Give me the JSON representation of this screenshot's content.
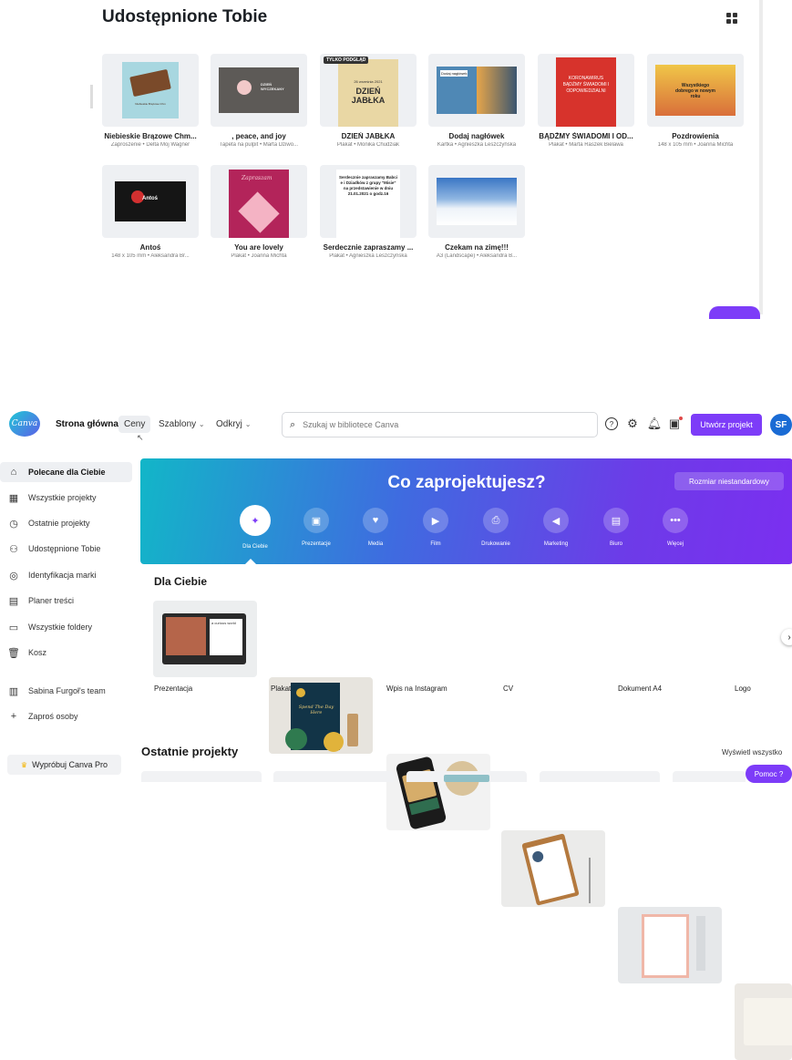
{
  "shared": {
    "title": "Udostępnione Tobie",
    "items": [
      {
        "title": "Niebieskie Brązowe Chm...",
        "meta": "Zaproszenie • Delta Moj Wagner",
        "tag": ""
      },
      {
        "title": ", peace, and joy",
        "meta": "Tapeta na pulpit • Marta Dziwo...",
        "tag": ""
      },
      {
        "title": "DZIEŃ JABŁKA",
        "meta": "Plakat • Monika Chudziak",
        "tag": "TYLKO PODGLĄD"
      },
      {
        "title": "Dodaj nagłówek",
        "meta": "Kartka • Agnieszka Leszczyńska",
        "tag": ""
      },
      {
        "title": "BĄDŹMY ŚWIADOMI I OD...",
        "meta": "Plakat • Marta Raszek Bielawa",
        "tag": ""
      },
      {
        "title": "Pozdrowienia",
        "meta": "148 x 105 mm • Joanna Michta",
        "tag": ""
      },
      {
        "title": "Antoś",
        "meta": "148 x 105 mm • Aleksandra Br...",
        "tag": ""
      },
      {
        "title": "You are lovely",
        "meta": "Plakat • Joanna Michta",
        "tag": ""
      },
      {
        "title": "Serdecznie zapraszamy ...",
        "meta": "Plakat • Agnieszka Leszczyńska",
        "tag": ""
      },
      {
        "title": "Czekam na zimę!!!",
        "meta": "A3 (Landscape) • Aleksandra B...",
        "tag": ""
      }
    ],
    "thumb_texts": {
      "choc": "Niebieskie Brązowe Chm",
      "dzien_small": "DZIEŃ WYCZEKANY",
      "apple_date": "26 września 2021",
      "apple_big": "DZIEŃ JABŁKA",
      "sea": "Dodaj nagłówek",
      "corona": "KORONAWIRUS BĄDŹMY ŚWIADOMI I ODPOWIEDZIALNI",
      "newyear": "Wszystkiego dobrego w nowym roku",
      "antos": "Antoś",
      "lovely": "Zapraszam",
      "invite": "Serdecznie zapraszamy Babci e i Dziadków z grupy \"Misie\" na przedstawienie w dniu 21.01.2021 o godz.16"
    }
  },
  "topbar": {
    "logo": "Canva",
    "home": "Strona główna",
    "prices": "Ceny",
    "templates": "Szablony",
    "discover": "Odkryj",
    "search_placeholder": "Szukaj w bibliotece Canva",
    "create": "Utwórz projekt",
    "avatar": "SF"
  },
  "sidebar": {
    "items": [
      {
        "label": "Polecane dla Ciebie",
        "icon": "home-icon"
      },
      {
        "label": "Wszystkie projekty",
        "icon": "grid-icon"
      },
      {
        "label": "Ostatnie projekty",
        "icon": "clock-icon"
      },
      {
        "label": "Udostępnione Tobie",
        "icon": "people-icon"
      },
      {
        "label": "Identyfikacja marki",
        "icon": "brand-icon"
      },
      {
        "label": "Planer treści",
        "icon": "calendar-icon"
      },
      {
        "label": "Wszystkie foldery",
        "icon": "folder-icon"
      },
      {
        "label": "Kosz",
        "icon": "trash-icon"
      },
      {
        "label": "Sabina Furgoł's team",
        "icon": "team-icon"
      },
      {
        "label": "Zaproś osoby",
        "icon": "plus-icon"
      }
    ],
    "try_pro": "Wypróbuj Canva Pro"
  },
  "hero": {
    "title": "Co zaprojektujesz?",
    "custom_size": "Rozmiar niestandardowy",
    "categories": [
      {
        "label": "Dla Ciebie",
        "icon": "sparkle-icon",
        "glyph": "✦"
      },
      {
        "label": "Prezentacje",
        "icon": "presentation-icon",
        "glyph": "▣"
      },
      {
        "label": "Media",
        "icon": "heart-chat-icon",
        "glyph": "♥"
      },
      {
        "label": "Film",
        "icon": "video-icon",
        "glyph": "▶"
      },
      {
        "label": "Drukowanie",
        "icon": "printer-icon",
        "glyph": "⎙"
      },
      {
        "label": "Marketing",
        "icon": "megaphone-icon",
        "glyph": "◀"
      },
      {
        "label": "Biuro",
        "icon": "briefcase-icon",
        "glyph": "▤"
      },
      {
        "label": "Więcej",
        "icon": "more-icon",
        "glyph": "•••"
      }
    ]
  },
  "foryou": {
    "title": "Dla Ciebie",
    "items": [
      "Prezentacja",
      "Plakat",
      "Wpis na Instagram",
      "CV",
      "Dokument A4",
      "Logo"
    ],
    "poster_text": "Spend The Day Here",
    "presentation_text": "a curious world"
  },
  "recent": {
    "title": "Ostatnie projekty",
    "view_all": "Wyświetl wszystko"
  },
  "help": "Pomoc ?",
  "colors": {
    "accent": "#7d3cf8",
    "avatar": "#1a6bd4"
  }
}
